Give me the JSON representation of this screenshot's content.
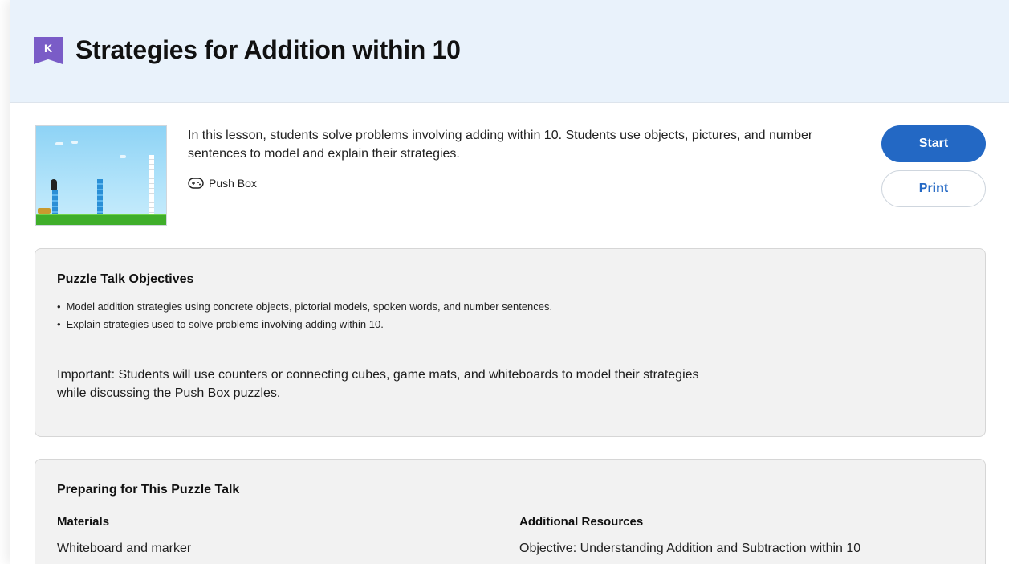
{
  "header": {
    "grade_badge": "K",
    "title": "Strategies for Addition within 10",
    "background": "#e9f2fb"
  },
  "lesson": {
    "description": "In this lesson, students solve problems involving adding within 10. Students use objects, pictures, and number sentences to model and explain their strategies.",
    "game_icon": "gamepad-icon",
    "game_name": "Push Box",
    "thumbnail": "push-box-game-thumbnail"
  },
  "actions": {
    "start_label": "Start",
    "print_label": "Print",
    "accent": "#2368c4"
  },
  "objectives": {
    "title": "Puzzle Talk Objectives",
    "items": [
      "Model addition strategies using concrete objects, pictorial models, spoken words, and number sentences.",
      "Explain strategies used to solve problems involving adding within 10."
    ],
    "important": "Important: Students will use counters or connecting cubes, game mats, and whiteboards to model their strategies while discussing the Push Box puzzles."
  },
  "preparing": {
    "title": "Preparing for This Puzzle Talk",
    "materials_title": "Materials",
    "materials": [
      "Whiteboard and marker"
    ],
    "resources_title": "Additional Resources",
    "resources": [
      "Objective: Understanding Addition and Subtraction within 10"
    ]
  }
}
